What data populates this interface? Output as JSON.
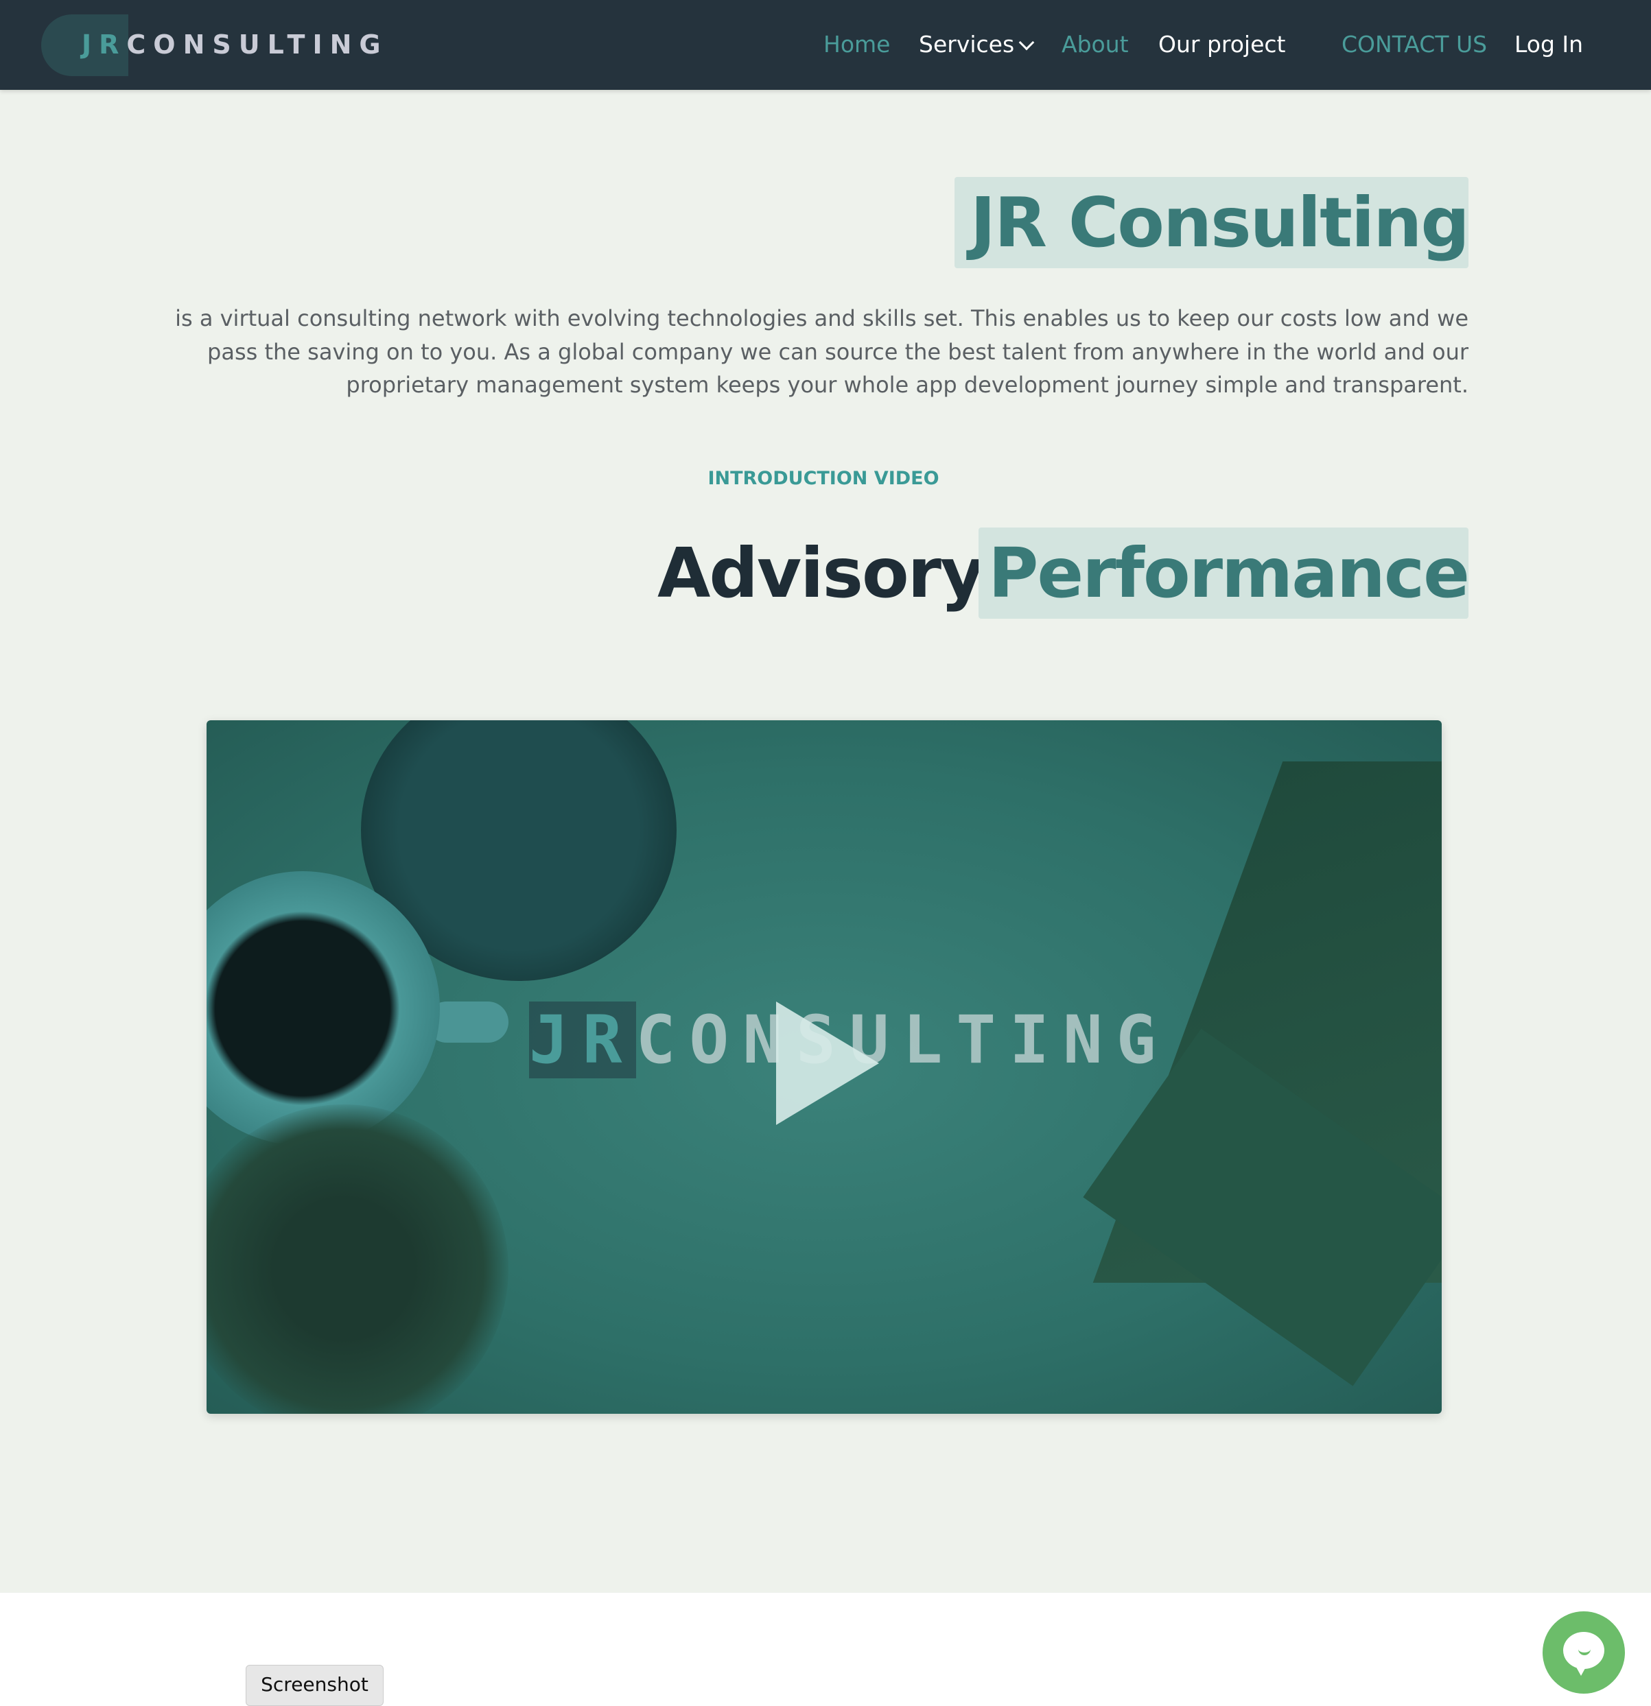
{
  "nav": {
    "logo_jr": "JR",
    "logo_rest": "CONSULTING",
    "items": [
      "Home",
      "Services",
      "About",
      "Our project",
      "CONTACT US",
      "Log In"
    ]
  },
  "hero": {
    "title": "JR Consulting",
    "description": "is a virtual consulting network with evolving technologies and skills set. This enables us to keep our costs low and we pass the saving on to you. As a global company we can source the best talent from anywhere in the world and our proprietary management system keeps your whole app development journey simple and transparent."
  },
  "video_section": {
    "eyebrow": "INTRODUCTION VIDEO",
    "heading_plain": "Advisory",
    "heading_highlight": "Performance",
    "video_logo_jr": "JR",
    "video_logo_rest": "CONSULTING"
  },
  "overlay": {
    "screenshot_label": "Screenshot"
  },
  "colors": {
    "nav_bg": "#25333d",
    "accent": "#3a7a78",
    "highlight_bg": "#d3e4df",
    "page_bg": "#eef2ec",
    "chat": "#6cbd6a"
  }
}
